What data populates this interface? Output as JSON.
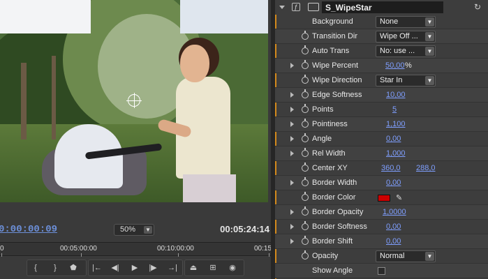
{
  "monitor": {
    "current_timecode": "0:00:00:09",
    "duration_timecode": "00:05:24:14",
    "zoom": "50%",
    "ruler_labels": [
      "0",
      "00:05:00:00",
      "00:10:00:00",
      "00:15"
    ]
  },
  "effect": {
    "name": "S_WipeStar",
    "params": [
      {
        "label": "Background",
        "type": "select",
        "value": "None",
        "expandable": false,
        "stopwatch": false
      },
      {
        "label": "Transition Dir",
        "type": "select",
        "value": "Wipe Off ...",
        "expandable": false,
        "stopwatch": true
      },
      {
        "label": "Auto Trans",
        "type": "select",
        "value": "No: use ...",
        "expandable": false,
        "stopwatch": true
      },
      {
        "label": "Wipe Percent",
        "type": "number",
        "value": "50,00",
        "unit": "%",
        "expandable": true,
        "stopwatch": true
      },
      {
        "label": "Wipe Direction",
        "type": "select",
        "value": "Star In",
        "expandable": false,
        "stopwatch": true
      },
      {
        "label": "Edge Softness",
        "type": "number",
        "value": "10,00",
        "expandable": true,
        "stopwatch": true
      },
      {
        "label": "Points",
        "type": "number",
        "value": "5",
        "expandable": true,
        "stopwatch": true
      },
      {
        "label": "Pointiness",
        "type": "number",
        "value": "1,100",
        "expandable": true,
        "stopwatch": true
      },
      {
        "label": "Angle",
        "type": "number",
        "value": "0,00",
        "expandable": true,
        "stopwatch": true
      },
      {
        "label": "Rel Width",
        "type": "number",
        "value": "1,000",
        "expandable": true,
        "stopwatch": true
      },
      {
        "label": "Center XY",
        "type": "xy",
        "value": "360,0",
        "value2": "288,0",
        "expandable": false,
        "stopwatch": true
      },
      {
        "label": "Border Width",
        "type": "number",
        "value": "0,00",
        "expandable": true,
        "stopwatch": true
      },
      {
        "label": "Border Color",
        "type": "color",
        "value": "#cc0000",
        "expandable": false,
        "stopwatch": true
      },
      {
        "label": "Border Opacity",
        "type": "number",
        "value": "1,0000",
        "expandable": true,
        "stopwatch": true
      },
      {
        "label": "Border Softness",
        "type": "number",
        "value": "0,00",
        "expandable": true,
        "stopwatch": true
      },
      {
        "label": "Border Shift",
        "type": "number",
        "value": "0,00",
        "expandable": true,
        "stopwatch": true
      },
      {
        "label": "Opacity",
        "type": "select",
        "value": "Normal",
        "expandable": false,
        "stopwatch": true
      },
      {
        "label": "Show Angle",
        "type": "checkbox",
        "value": false,
        "expandable": false,
        "stopwatch": false
      }
    ]
  },
  "colors": {
    "accent_amber": "#d48a1c",
    "value_blue": "#7f9fff",
    "timecode_blue": "#6c8fd8"
  },
  "transport_icons": [
    "mark-in-icon",
    "mark-out-icon",
    "marker-icon",
    "go-to-in-icon",
    "step-back-icon",
    "play-icon",
    "step-forward-icon",
    "go-to-out-icon",
    "lift-icon",
    "extract-icon",
    "export-frame-icon"
  ]
}
